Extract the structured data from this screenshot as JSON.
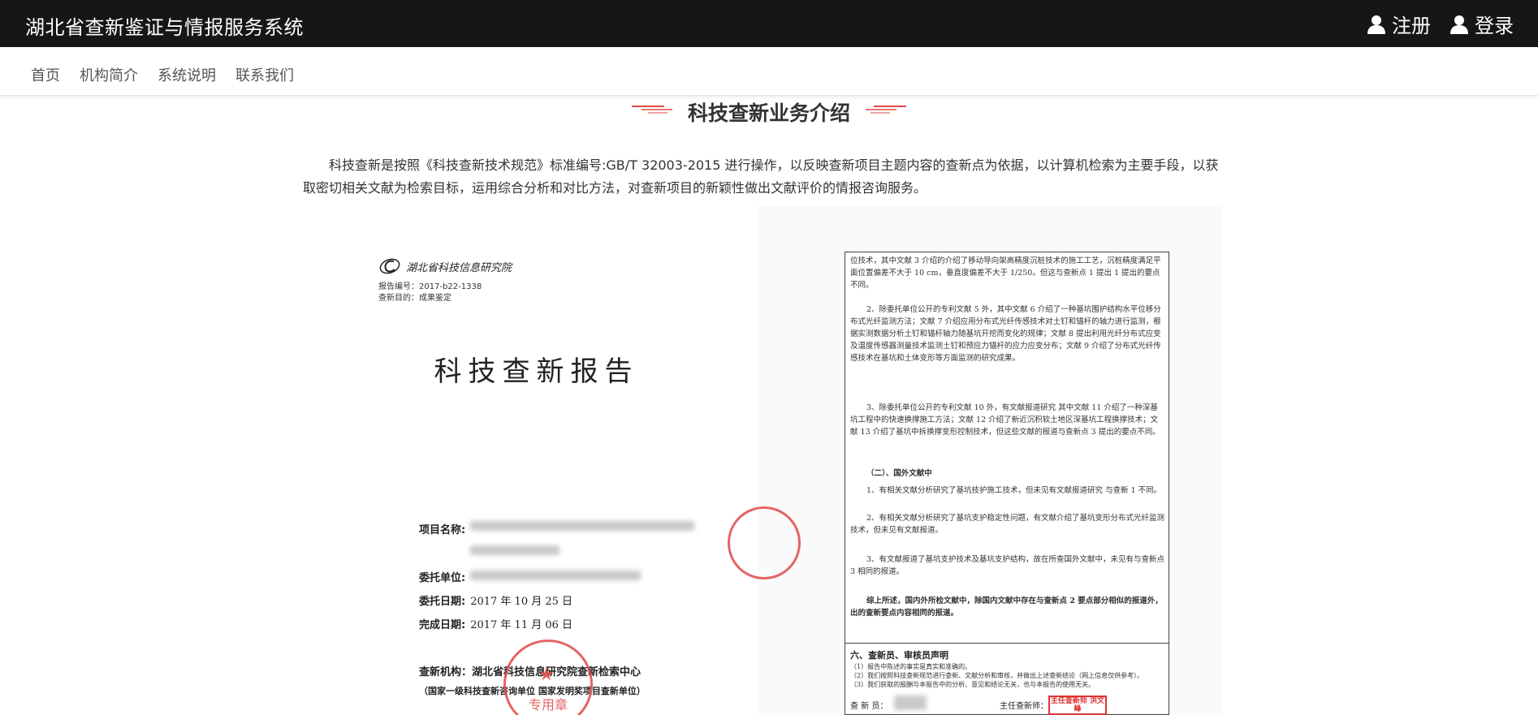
{
  "header": {
    "site_title": "湖北省查新鉴证与情报服务系统",
    "register_label": "注册",
    "login_label": "登录"
  },
  "nav": {
    "items": [
      "首页",
      "机构简介",
      "系统说明",
      "联系我们"
    ]
  },
  "main": {
    "section_title": "科技查新业务介绍",
    "intro_text": "科技查新是按照《科技查新技术规范》标准编号:GB/T 32003-2015 进行操作，以反映查新项目主题内容的查新点为依据，以计算机检索为主要手段，以获取密切相关文献为检索目标，运用综合分析和对比方法，对查新项目的新颖性做出文献评价的情报咨询服务。"
  },
  "figure": {
    "left_page": {
      "org_logo_text": "湖北省科技信息研究院",
      "report_number": "报告编号：2017-b22-1338",
      "purpose": "查新目的：成果鉴定",
      "title": "科技查新报告",
      "project_label": "项目名称:",
      "client_label": "委托单位:",
      "commission_date_label": "委托日期:",
      "commission_date": "2017 年 10 月 25 日",
      "completion_date_label": "完成日期:",
      "completion_date": "2017 年 11 月 06 日",
      "agency": "查新机构：湖北省科技信息研究院查新检索中心",
      "agency_note": "（国家一级科技查新咨询单位  国家发明奖项目查新单位）",
      "stamp_text": "专用章"
    },
    "right_page": {
      "p1": "位技术，其中文献 3 介绍的介绍了移动导向架高精度沉桩技术的施工工艺，沉桩精度满足平面位置偏差不大于 10 cm，垂直度偏差不大于 1/250。但这与查新点 1 提出 1 提出的要点不同。",
      "p2": "2、除委托单位公开的专利文献 5 外，其中文献 6 介绍了一种基坑围护结构水平位移分布式光纤监测方法；文献 7 介绍应用分布式光纤传感技术对土钉和锚杆的轴力进行监测，根据实测数据分析土钉和锚杆轴力随基坑开挖而变化的规律；文献 8 提出利用光纤分布式应变及温度传感器测量技术监测土钉和预应力锚杆的应力应变分布；文献 9 介绍了分布式光纤传感技术在基坑和土体变形等方面监测的研究成果。",
      "p3": "3、除委托单位公开的专利文献 10 外，有文献报道研究 其中文献 11 介绍了一种深基坑工程中的快速换撑施工方法；文献 12 介绍了新近沉积软土地区深基坑工程换撑技术；文献 13 介绍了基坑中拆换撑变形控制技术，但这些文献的报道与查新点 3 提出的要点不同。",
      "foreign_head": "（二）、国外文献中",
      "p4": "1、有相关文献分析研究了基坑技护施工技术，但未见有文献报道研究 与查新 1 不同。",
      "p5": "2、有相关文献分析研究了基坑支护稳定性问题，有文献介绍了基坑变形分布式光纤监测技术，但未见有文献报道。",
      "p6": "3、有文献报道了基坑支护技术及基坑支护结构，故在所查国外文献中，未见有与查新点 3 相同的报道。",
      "p7": "综上所述，国内外所检文献中，除国内文献中存在与查新点 2 要点部分相似的报道外，出的查新要点内容相同的报道。",
      "section_six": "六、查新员、审核员声明",
      "decl1": "（1）报告中陈述的事实是真实和准确的。",
      "decl2": "（2）我们按照科技查新规范进行查新、文献分析和审核，并做出上述查新结论（网上信息仅供参考）。",
      "decl3": "（3）我们获取的报酬与本报告中的分析、意见和结论无关，也与本报告的使用无关。",
      "searcher_label": "查 新 员：",
      "chief_label": "主任查新师：",
      "chief_stamp": "主任查新师 洪文峰"
    }
  }
}
